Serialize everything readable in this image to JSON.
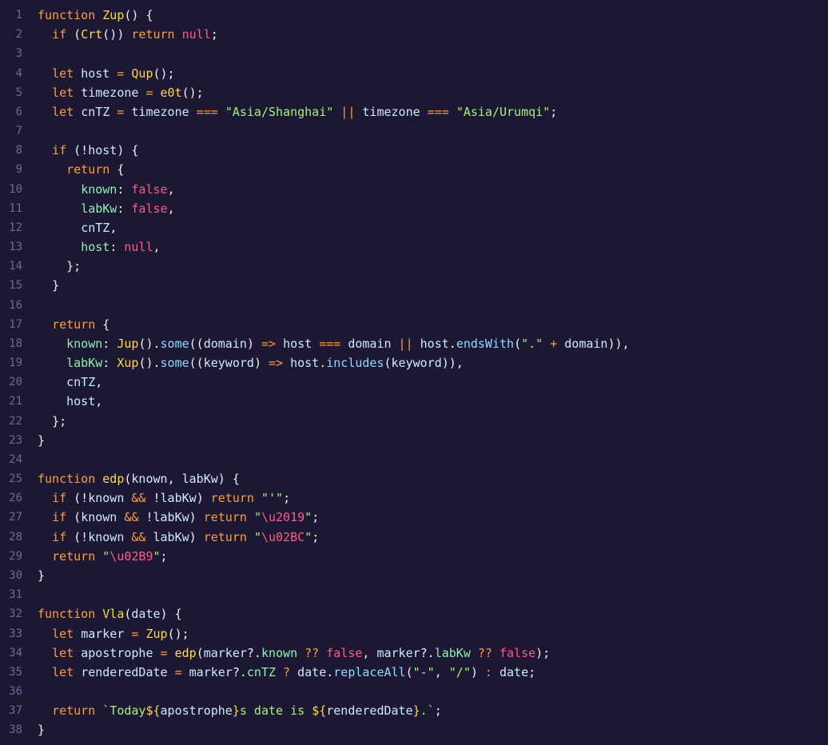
{
  "editor": {
    "colors": {
      "background": "#1c1833",
      "gutter": "#6b6a9a",
      "keyword": "#ff9d3d",
      "function": "#ffd84a",
      "string": "#a6f07a",
      "literal": "#ff5a8a",
      "property": "#8ef0b8",
      "method": "#8fd9ff"
    },
    "lines": [
      [
        [
          "kw",
          "function"
        ],
        [
          "plain",
          " "
        ],
        [
          "fn",
          "Zup"
        ],
        [
          "punc",
          "() {"
        ]
      ],
      [
        [
          "plain",
          "  "
        ],
        [
          "kw",
          "if"
        ],
        [
          "punc",
          " ("
        ],
        [
          "fn",
          "Crt"
        ],
        [
          "punc",
          "()) "
        ],
        [
          "kw",
          "return"
        ],
        [
          "plain",
          " "
        ],
        [
          "lit",
          "null"
        ],
        [
          "punc",
          ";"
        ]
      ],
      [],
      [
        [
          "plain",
          "  "
        ],
        [
          "kw",
          "let"
        ],
        [
          "plain",
          " "
        ],
        [
          "var",
          "host"
        ],
        [
          "op",
          " = "
        ],
        [
          "fn",
          "Qup"
        ],
        [
          "punc",
          "();"
        ]
      ],
      [
        [
          "plain",
          "  "
        ],
        [
          "kw",
          "let"
        ],
        [
          "plain",
          " "
        ],
        [
          "var",
          "timezone"
        ],
        [
          "op",
          " = "
        ],
        [
          "fn",
          "e0t"
        ],
        [
          "punc",
          "();"
        ]
      ],
      [
        [
          "plain",
          "  "
        ],
        [
          "kw",
          "let"
        ],
        [
          "plain",
          " "
        ],
        [
          "var",
          "cnTZ"
        ],
        [
          "op",
          " = "
        ],
        [
          "var",
          "timezone"
        ],
        [
          "op",
          " === "
        ],
        [
          "str",
          "\"Asia/Shanghai\""
        ],
        [
          "op",
          " || "
        ],
        [
          "var",
          "timezone"
        ],
        [
          "op",
          " === "
        ],
        [
          "str",
          "\"Asia/Urumqi\""
        ],
        [
          "punc",
          ";"
        ]
      ],
      [],
      [
        [
          "plain",
          "  "
        ],
        [
          "kw",
          "if"
        ],
        [
          "punc",
          " (!"
        ],
        [
          "var",
          "host"
        ],
        [
          "punc",
          ") {"
        ]
      ],
      [
        [
          "plain",
          "    "
        ],
        [
          "kw",
          "return"
        ],
        [
          "punc",
          " {"
        ]
      ],
      [
        [
          "plain",
          "      "
        ],
        [
          "prop",
          "known"
        ],
        [
          "punc",
          ": "
        ],
        [
          "lit",
          "false"
        ],
        [
          "punc",
          ","
        ]
      ],
      [
        [
          "plain",
          "      "
        ],
        [
          "prop",
          "labKw"
        ],
        [
          "punc",
          ": "
        ],
        [
          "lit",
          "false"
        ],
        [
          "punc",
          ","
        ]
      ],
      [
        [
          "plain",
          "      "
        ],
        [
          "var",
          "cnTZ"
        ],
        [
          "punc",
          ","
        ]
      ],
      [
        [
          "plain",
          "      "
        ],
        [
          "prop",
          "host"
        ],
        [
          "punc",
          ": "
        ],
        [
          "lit",
          "null"
        ],
        [
          "punc",
          ","
        ]
      ],
      [
        [
          "plain",
          "    "
        ],
        [
          "punc",
          "};"
        ]
      ],
      [
        [
          "plain",
          "  "
        ],
        [
          "punc",
          "}"
        ]
      ],
      [],
      [
        [
          "plain",
          "  "
        ],
        [
          "kw",
          "return"
        ],
        [
          "punc",
          " {"
        ]
      ],
      [
        [
          "plain",
          "    "
        ],
        [
          "prop",
          "known"
        ],
        [
          "punc",
          ": "
        ],
        [
          "fn",
          "Jup"
        ],
        [
          "punc",
          "()."
        ],
        [
          "method",
          "some"
        ],
        [
          "punc",
          "(("
        ],
        [
          "var",
          "domain"
        ],
        [
          "punc",
          ") "
        ],
        [
          "op",
          "=>"
        ],
        [
          "plain",
          " "
        ],
        [
          "var",
          "host"
        ],
        [
          "op",
          " === "
        ],
        [
          "var",
          "domain"
        ],
        [
          "op",
          " || "
        ],
        [
          "var",
          "host"
        ],
        [
          "punc",
          "."
        ],
        [
          "method",
          "endsWith"
        ],
        [
          "punc",
          "("
        ],
        [
          "str",
          "\".\""
        ],
        [
          "op",
          " + "
        ],
        [
          "var",
          "domain"
        ],
        [
          "punc",
          "))"
        ],
        [
          "punc",
          ","
        ]
      ],
      [
        [
          "plain",
          "    "
        ],
        [
          "prop",
          "labKw"
        ],
        [
          "punc",
          ": "
        ],
        [
          "fn",
          "Xup"
        ],
        [
          "punc",
          "()."
        ],
        [
          "method",
          "some"
        ],
        [
          "punc",
          "(("
        ],
        [
          "var",
          "keyword"
        ],
        [
          "punc",
          ") "
        ],
        [
          "op",
          "=>"
        ],
        [
          "plain",
          " "
        ],
        [
          "var",
          "host"
        ],
        [
          "punc",
          "."
        ],
        [
          "method",
          "includes"
        ],
        [
          "punc",
          "("
        ],
        [
          "var",
          "keyword"
        ],
        [
          "punc",
          "))"
        ],
        [
          "punc",
          ","
        ]
      ],
      [
        [
          "plain",
          "    "
        ],
        [
          "var",
          "cnTZ"
        ],
        [
          "punc",
          ","
        ]
      ],
      [
        [
          "plain",
          "    "
        ],
        [
          "var",
          "host"
        ],
        [
          "punc",
          ","
        ]
      ],
      [
        [
          "plain",
          "  "
        ],
        [
          "punc",
          "};"
        ]
      ],
      [
        [
          "punc",
          "}"
        ]
      ],
      [],
      [
        [
          "kw",
          "function"
        ],
        [
          "plain",
          " "
        ],
        [
          "fn",
          "edp"
        ],
        [
          "punc",
          "("
        ],
        [
          "var",
          "known"
        ],
        [
          "punc",
          ", "
        ],
        [
          "var",
          "labKw"
        ],
        [
          "punc",
          ") {"
        ]
      ],
      [
        [
          "plain",
          "  "
        ],
        [
          "kw",
          "if"
        ],
        [
          "punc",
          " (!"
        ],
        [
          "var",
          "known"
        ],
        [
          "op",
          " && "
        ],
        [
          "punc",
          "!"
        ],
        [
          "var",
          "labKw"
        ],
        [
          "punc",
          ") "
        ],
        [
          "kw",
          "return"
        ],
        [
          "plain",
          " "
        ],
        [
          "str",
          "\"'\""
        ],
        [
          "punc",
          ";"
        ]
      ],
      [
        [
          "plain",
          "  "
        ],
        [
          "kw",
          "if"
        ],
        [
          "punc",
          " ("
        ],
        [
          "var",
          "known"
        ],
        [
          "op",
          " && "
        ],
        [
          "punc",
          "!"
        ],
        [
          "var",
          "labKw"
        ],
        [
          "punc",
          ") "
        ],
        [
          "kw",
          "return"
        ],
        [
          "plain",
          " "
        ],
        [
          "str",
          "\""
        ],
        [
          "esc",
          "\\u2019"
        ],
        [
          "str",
          "\""
        ],
        [
          "punc",
          ";"
        ]
      ],
      [
        [
          "plain",
          "  "
        ],
        [
          "kw",
          "if"
        ],
        [
          "punc",
          " (!"
        ],
        [
          "var",
          "known"
        ],
        [
          "op",
          " && "
        ],
        [
          "var",
          "labKw"
        ],
        [
          "punc",
          ") "
        ],
        [
          "kw",
          "return"
        ],
        [
          "plain",
          " "
        ],
        [
          "str",
          "\""
        ],
        [
          "esc",
          "\\u02BC"
        ],
        [
          "str",
          "\""
        ],
        [
          "punc",
          ";"
        ]
      ],
      [
        [
          "plain",
          "  "
        ],
        [
          "kw",
          "return"
        ],
        [
          "plain",
          " "
        ],
        [
          "str",
          "\""
        ],
        [
          "esc",
          "\\u02B9"
        ],
        [
          "str",
          "\""
        ],
        [
          "punc",
          ";"
        ]
      ],
      [
        [
          "punc",
          "}"
        ]
      ],
      [],
      [
        [
          "kw",
          "function"
        ],
        [
          "plain",
          " "
        ],
        [
          "fn",
          "Vla"
        ],
        [
          "punc",
          "("
        ],
        [
          "var",
          "date"
        ],
        [
          "punc",
          ") {"
        ]
      ],
      [
        [
          "plain",
          "  "
        ],
        [
          "kw",
          "let"
        ],
        [
          "plain",
          " "
        ],
        [
          "var",
          "marker"
        ],
        [
          "op",
          " = "
        ],
        [
          "fn",
          "Zup"
        ],
        [
          "punc",
          "();"
        ]
      ],
      [
        [
          "plain",
          "  "
        ],
        [
          "kw",
          "let"
        ],
        [
          "plain",
          " "
        ],
        [
          "var",
          "apostrophe"
        ],
        [
          "op",
          " = "
        ],
        [
          "fn",
          "edp"
        ],
        [
          "punc",
          "("
        ],
        [
          "var",
          "marker"
        ],
        [
          "punc",
          "?."
        ],
        [
          "prop",
          "known"
        ],
        [
          "op",
          " ?? "
        ],
        [
          "lit",
          "false"
        ],
        [
          "punc",
          ", "
        ],
        [
          "var",
          "marker"
        ],
        [
          "punc",
          "?."
        ],
        [
          "prop",
          "labKw"
        ],
        [
          "op",
          " ?? "
        ],
        [
          "lit",
          "false"
        ],
        [
          "punc",
          ");"
        ]
      ],
      [
        [
          "plain",
          "  "
        ],
        [
          "kw",
          "let"
        ],
        [
          "plain",
          " "
        ],
        [
          "var",
          "renderedDate"
        ],
        [
          "op",
          " = "
        ],
        [
          "var",
          "marker"
        ],
        [
          "punc",
          "?."
        ],
        [
          "prop",
          "cnTZ"
        ],
        [
          "op",
          " ? "
        ],
        [
          "var",
          "date"
        ],
        [
          "punc",
          "."
        ],
        [
          "method",
          "replaceAll"
        ],
        [
          "punc",
          "("
        ],
        [
          "str",
          "\"-\""
        ],
        [
          "punc",
          ", "
        ],
        [
          "str",
          "\"/\""
        ],
        [
          "punc",
          ")"
        ],
        [
          "op",
          " : "
        ],
        [
          "var",
          "date"
        ],
        [
          "punc",
          ";"
        ]
      ],
      [],
      [
        [
          "plain",
          "  "
        ],
        [
          "kw",
          "return"
        ],
        [
          "plain",
          " "
        ],
        [
          "tmpl",
          "`Today"
        ],
        [
          "tint",
          "${"
        ],
        [
          "var",
          "apostrophe"
        ],
        [
          "tint",
          "}"
        ],
        [
          "tmpl",
          "s date is "
        ],
        [
          "tint",
          "${"
        ],
        [
          "var",
          "renderedDate"
        ],
        [
          "tint",
          "}"
        ],
        [
          "tmpl",
          ".`"
        ],
        [
          "punc",
          ";"
        ]
      ],
      [
        [
          "punc",
          "}"
        ]
      ]
    ]
  }
}
